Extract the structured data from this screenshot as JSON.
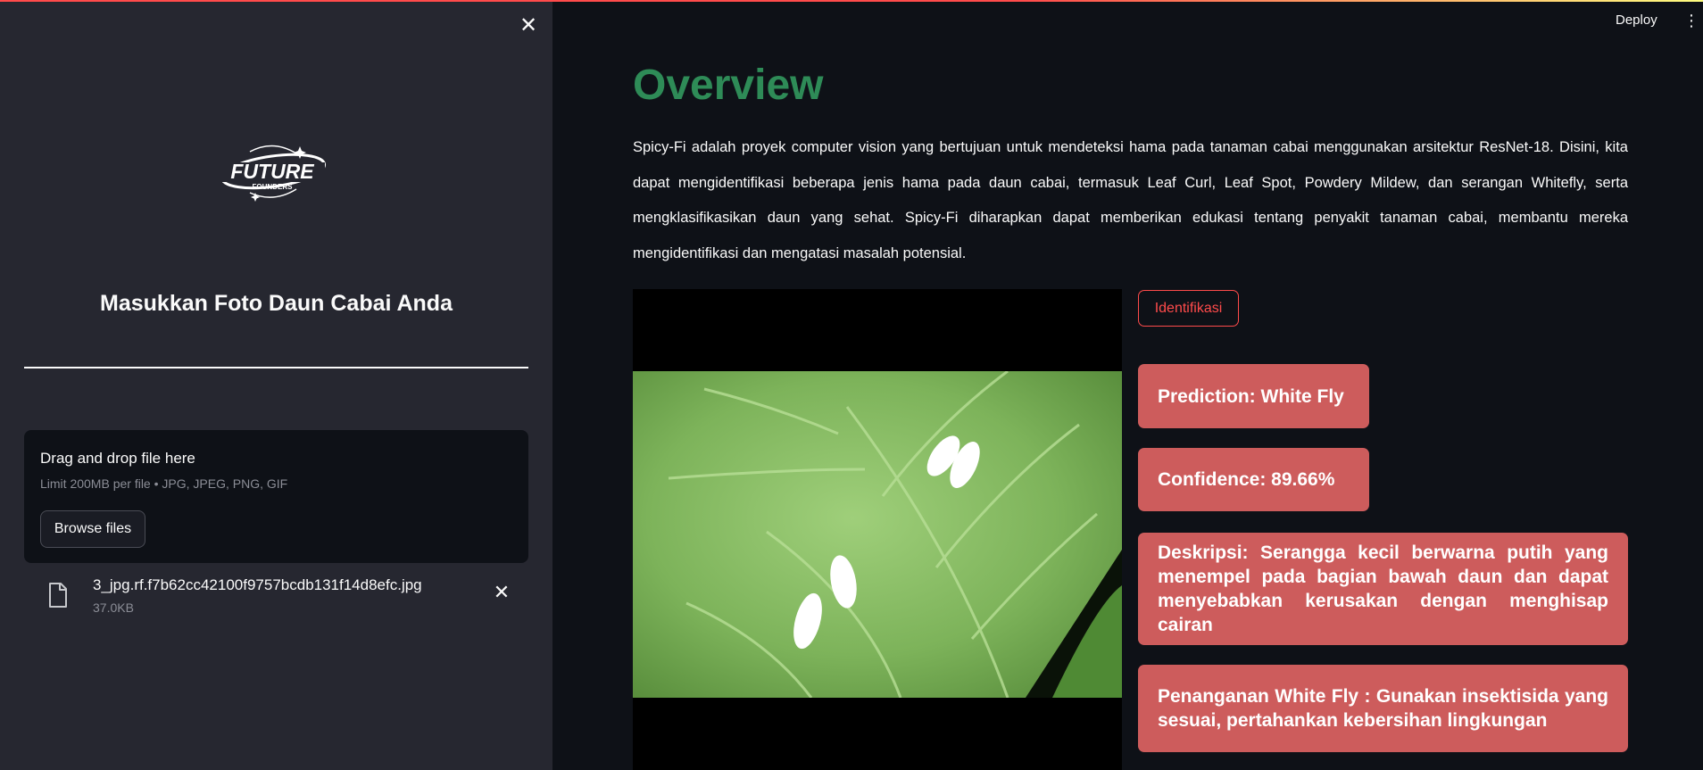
{
  "header": {
    "deploy_label": "Deploy"
  },
  "sidebar": {
    "logo_text": "FUTURE FOUNDERS",
    "title": "Masukkan Foto Daun Cabai Anda",
    "uploader": {
      "drag_text": "Drag and drop file here",
      "limit_text": "Limit 200MB per file • JPG, JPEG, PNG, GIF",
      "browse_label": "Browse files"
    },
    "file": {
      "name": "3_jpg.rf.f7b62cc42100f9757bcdb131f14d8efc.jpg",
      "size": "37.0KB"
    }
  },
  "main": {
    "title": "Overview",
    "description": "Spicy-Fi adalah proyek computer vision yang bertujuan untuk mendeteksi hama pada tanaman cabai menggunakan arsitektur ResNet-18. Disini, kita dapat mengidentifikasi beberapa jenis hama pada daun cabai, termasuk Leaf Curl, Leaf Spot, Powdery Mildew, dan serangan Whitefly, serta mengklasifikasikan daun yang sehat. Spicy-Fi diharapkan dapat memberikan edukasi tentang penyakit tanaman cabai, membantu mereka mengidentifikasi dan mengatasi masalah potensial.",
    "identify_label": "Identifikasi",
    "results": {
      "prediction": "Prediction: White Fly",
      "confidence": "Confidence: 89.66%",
      "description": "Deskripsi: Serangga kecil berwarna putih yang menempel pada bagian bawah daun dan dapat menyebabkan kerusakan dengan menghisap cairan",
      "treatment": "Penanganan White Fly : Gunakan insektisida yang sesuai, pertahankan kebersihan lingkungan"
    }
  },
  "colors": {
    "title_green": "#2e8b57",
    "card_red": "#cd5c5c",
    "accent_red": "#ff4b4b",
    "sidebar_bg": "#262730",
    "main_bg": "#0e1117"
  }
}
